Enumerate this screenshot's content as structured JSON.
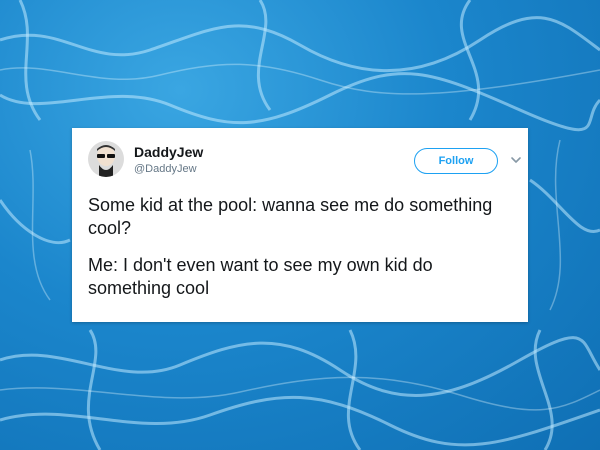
{
  "background": {
    "description_colors": [
      "#3aa6e2",
      "#1b86cc",
      "#0f6fb4"
    ]
  },
  "tweet": {
    "display_name": "DaddyJew",
    "handle": "@DaddyJew",
    "follow_label": "Follow",
    "paragraphs": [
      "Some kid at the pool: wanna see me do something cool?",
      "Me: I don't even want to see my own kid do something cool"
    ]
  },
  "icons": {
    "avatar": "avatar-photo",
    "more": "chevron-down-icon"
  },
  "colors": {
    "accent": "#1da1f2",
    "text": "#14171a",
    "muted": "#657786",
    "card": "#ffffff"
  }
}
